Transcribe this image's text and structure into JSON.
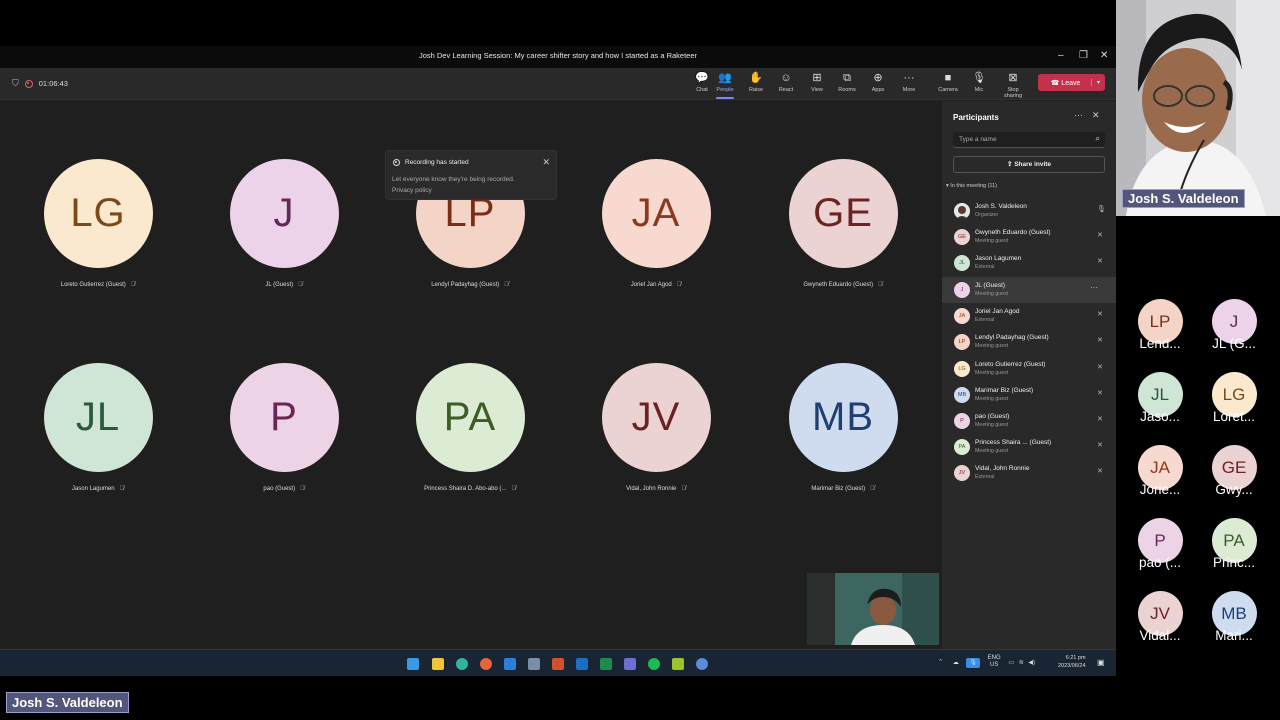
{
  "window": {
    "title": "Josh Dev Learning Session: My career shifter story and how I started as a Raketeer"
  },
  "toolbar": {
    "timer": "01:06:43",
    "buttons": [
      {
        "label": "Chat",
        "icon": "chat-icon",
        "glyph": "💬"
      },
      {
        "label": "People",
        "icon": "people-icon",
        "glyph": "👥"
      },
      {
        "label": "Raise",
        "icon": "raise-hand-icon",
        "glyph": "✋"
      },
      {
        "label": "React",
        "icon": "react-icon",
        "glyph": "☺"
      },
      {
        "label": "View",
        "icon": "view-icon",
        "glyph": "⊞"
      },
      {
        "label": "Rooms",
        "icon": "rooms-icon",
        "glyph": "⧉"
      },
      {
        "label": "Apps",
        "icon": "apps-icon",
        "glyph": "⊕"
      },
      {
        "label": "More",
        "icon": "more-icon",
        "glyph": "···"
      },
      {
        "label": "Camera",
        "icon": "camera-icon",
        "glyph": "■"
      },
      {
        "label": "Mic",
        "icon": "mic-icon",
        "glyph": "🎙"
      },
      {
        "label": "Stop sharing",
        "icon": "stop-share-icon",
        "glyph": "⊠"
      }
    ],
    "leave": "Leave",
    "accent": "#7f85f5",
    "leave_color": "#c4314b"
  },
  "toast": {
    "title": "Recording has started",
    "body": "Let everyone know they're being recorded.",
    "link": "Privacy policy"
  },
  "tiles": [
    {
      "initials": "LG",
      "name": "Loreto Gutierrez (Guest)",
      "bg": "#fbe9cf",
      "fg": "#7a4a1a"
    },
    {
      "initials": "J",
      "name": "JL (Guest)",
      "bg": "#ecd3ea",
      "fg": "#5e2a57"
    },
    {
      "initials": "LP",
      "name": "Lendyl Padayhag (Guest)",
      "bg": "#f5d4c8",
      "fg": "#7a2e18"
    },
    {
      "initials": "JA",
      "name": "Joriel Jan Agod",
      "bg": "#f8d9cf",
      "fg": "#8a3a21"
    },
    {
      "initials": "GE",
      "name": "Gwyneth Eduardo (Guest)",
      "bg": "#ecd3d3",
      "fg": "#6e2222"
    },
    {
      "initials": "JL",
      "name": "Jason Lagumen",
      "bg": "#cfe5d6",
      "fg": "#2a5a3a"
    },
    {
      "initials": "P",
      "name": "pao (Guest)",
      "bg": "#ecd3e6",
      "fg": "#6a2456"
    },
    {
      "initials": "PA",
      "name": "Princess Shaira D. Abo-abo (...",
      "bg": "#dcebd3",
      "fg": "#3c5c28"
    },
    {
      "initials": "JV",
      "name": "Vidal, John Ronnie",
      "bg": "#ecd3d3",
      "fg": "#6a2222"
    },
    {
      "initials": "MB",
      "name": "Marimar Biz (Guest)",
      "bg": "#cfdcef",
      "fg": "#1f3f72"
    }
  ],
  "panel": {
    "title": "Participants",
    "search_placeholder": "Type a name",
    "share_invite": "Share invite",
    "section": "In this meeting (11)",
    "participants": [
      {
        "initials": "",
        "name": "Josh S. Valdeleon",
        "role": "Organizer",
        "bg": "#dcdcdc",
        "fg": "#333",
        "mic": "🎙",
        "photo": true
      },
      {
        "initials": "GE",
        "name": "Gwyneth Eduardo (Guest)",
        "role": "Meeting guest",
        "bg": "#ecd3d3",
        "fg": "#6e2222",
        "mic": "✕"
      },
      {
        "initials": "JL",
        "name": "Jason Lagumen",
        "role": "External",
        "bg": "#cfe5d6",
        "fg": "#2a5a3a",
        "mic": "✕"
      },
      {
        "initials": "J",
        "name": "JL (Guest)",
        "role": "Meeting guest",
        "bg": "#ecd3ea",
        "fg": "#5e2a57",
        "mic": "···",
        "highlight": true
      },
      {
        "initials": "JA",
        "name": "Joriel Jan Agod",
        "role": "External",
        "bg": "#f8d9cf",
        "fg": "#8a3a21",
        "mic": "✕"
      },
      {
        "initials": "LP",
        "name": "Lendyl Padayhag (Guest)",
        "role": "Meeting guest",
        "bg": "#f5d4c8",
        "fg": "#7a2e18",
        "mic": "✕"
      },
      {
        "initials": "LG",
        "name": "Loreto Gutierrez (Guest)",
        "role": "Meeting guest",
        "bg": "#fbe9cf",
        "fg": "#7a4a1a",
        "mic": "✕"
      },
      {
        "initials": "MB",
        "name": "Marimar Biz (Guest)",
        "role": "Meeting guest",
        "bg": "#cfdcef",
        "fg": "#1f3f72",
        "mic": "✕"
      },
      {
        "initials": "P",
        "name": "pao (Guest)",
        "role": "Meeting guest",
        "bg": "#ecd3e6",
        "fg": "#6a2456",
        "mic": "✕"
      },
      {
        "initials": "PA",
        "name": "Princess Shaira ...   (Guest)",
        "role": "Meeting guest",
        "bg": "#dcebd3",
        "fg": "#3c5c28",
        "mic": "✕"
      },
      {
        "initials": "JV",
        "name": "Vidal, John Ronnie",
        "role": "External",
        "bg": "#ecd3d3",
        "fg": "#6a2222",
        "mic": "✕"
      }
    ]
  },
  "taskbar": {
    "tray_lang": "ENG",
    "tray_region": "US",
    "time": "6:21 pm",
    "date": "2023/06/24"
  },
  "speaker": {
    "name": "Josh S. Valdeleon"
  },
  "gallery": [
    {
      "initials": "LP",
      "name": "Lend...",
      "bg": "#f5d4c8",
      "fg": "#7a2e18"
    },
    {
      "initials": "J",
      "name": "JL (G...",
      "bg": "#ecd3ea",
      "fg": "#5e2a57"
    },
    {
      "initials": "JL",
      "name": "Jaso...",
      "bg": "#cfe5d6",
      "fg": "#2a5a3a"
    },
    {
      "initials": "LG",
      "name": "Loret...",
      "bg": "#fbe9cf",
      "fg": "#7a4a1a"
    },
    {
      "initials": "JA",
      "name": "Jorie...",
      "bg": "#f8d9cf",
      "fg": "#8a3a21"
    },
    {
      "initials": "GE",
      "name": "Gwy...",
      "bg": "#ecd3d3",
      "fg": "#6e2222"
    },
    {
      "initials": "P",
      "name": "pao (...",
      "bg": "#ecd3e6",
      "fg": "#6a2456"
    },
    {
      "initials": "PA",
      "name": "Princ...",
      "bg": "#dcebd3",
      "fg": "#3c5c28"
    },
    {
      "initials": "JV",
      "name": "Vidal...",
      "bg": "#ecd3d3",
      "fg": "#6a2222"
    },
    {
      "initials": "MB",
      "name": "Mari...",
      "bg": "#cfdcef",
      "fg": "#1f3f72"
    }
  ],
  "bottom_label": "Josh S. Valdeleon"
}
